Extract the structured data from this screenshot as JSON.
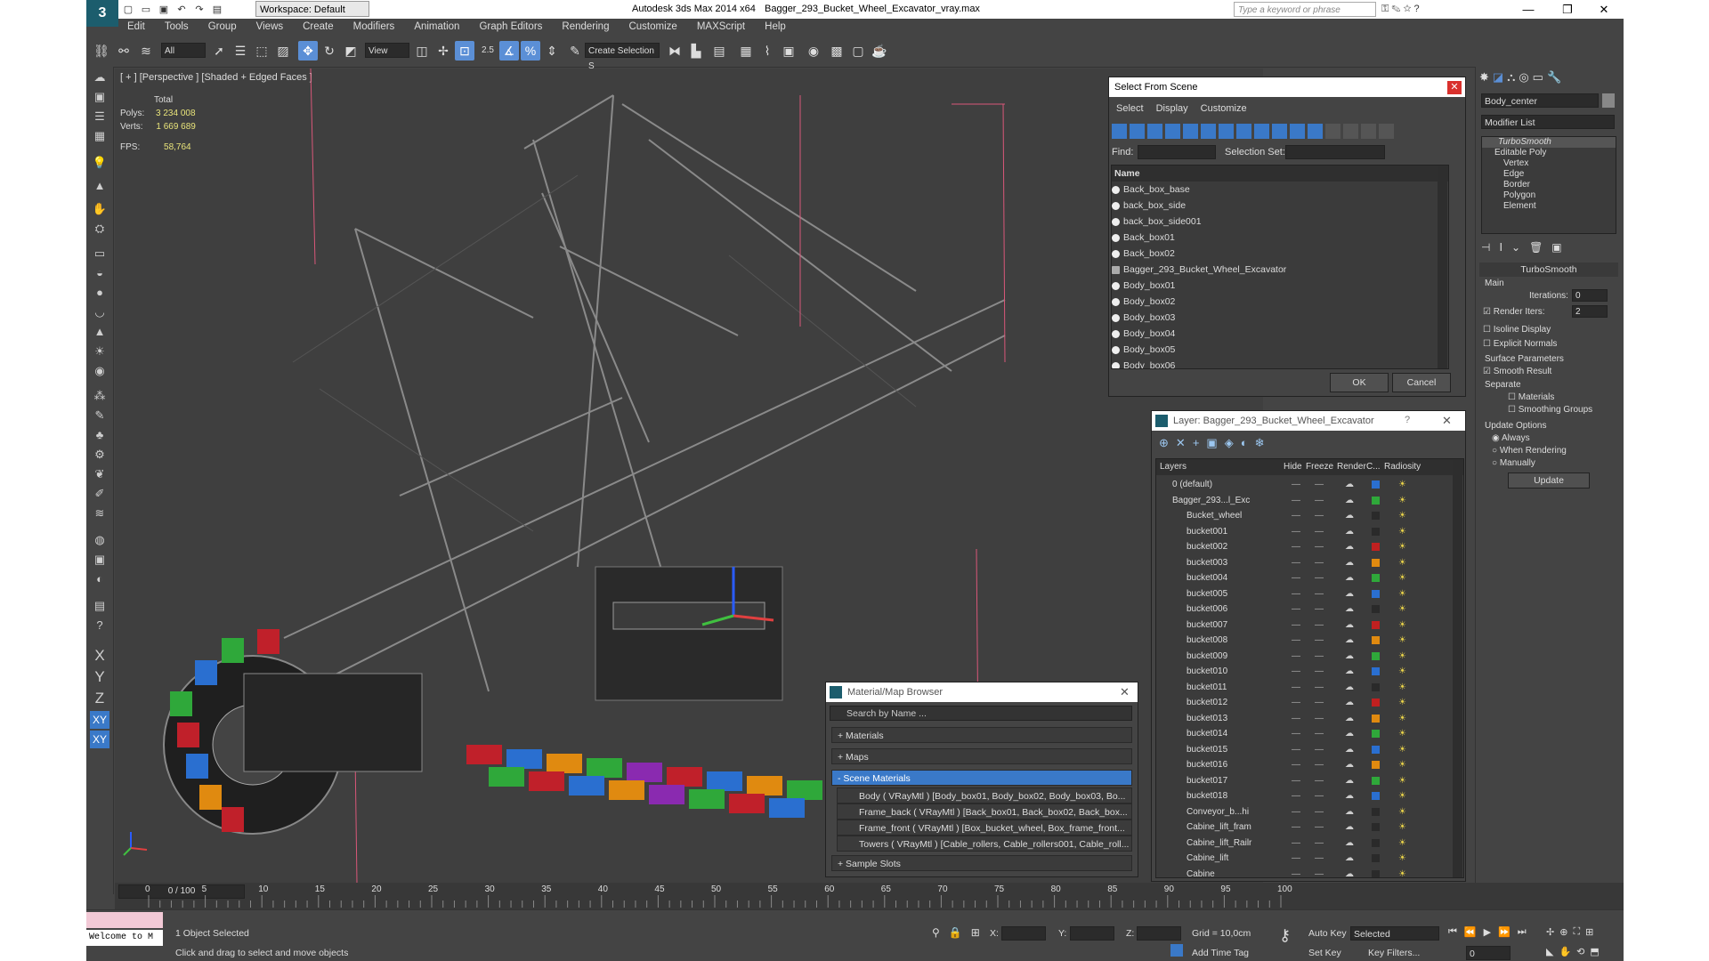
{
  "app": {
    "title": "Autodesk 3ds Max  2014 x64",
    "file": "Bagger_293_Bucket_Wheel_Excavator_vray.max",
    "workspace": "Workspace: Default",
    "search_placeholder": "Type a keyword or phrase",
    "logo": "3"
  },
  "menu": [
    "Edit",
    "Tools",
    "Group",
    "Views",
    "Create",
    "Modifiers",
    "Animation",
    "Graph Editors",
    "Rendering",
    "Customize",
    "MAXScript",
    "Help"
  ],
  "toolbar": {
    "filter": "All",
    "ref_coord": "View",
    "snap_value": "2.5",
    "selection_set": "Create Selection S"
  },
  "viewport": {
    "label": "[ + ] [Perspective ] [Shaded + Edged Faces ]",
    "stats": {
      "header": "Total",
      "polys_label": "Polys:",
      "polys": "3 234 008",
      "verts_label": "Verts:",
      "verts": "1 669 689",
      "fps_label": "FPS:",
      "fps": "58,764"
    }
  },
  "select_from_scene": {
    "title": "Select From Scene",
    "menu": [
      "Select",
      "Display",
      "Customize"
    ],
    "find_label": "Find:",
    "selset_label": "Selection Set:",
    "col_name": "Name",
    "items": [
      "Back_box_base",
      "back_box_side",
      "back_box_side001",
      "Back_box01",
      "Back_box02",
      "Bagger_293_Bucket_Wheel_Excavator",
      "Body_box01",
      "Body_box02",
      "Body_box03",
      "Body_box04",
      "Body_box05",
      "Body_box06"
    ],
    "ok": "OK",
    "cancel": "Cancel"
  },
  "layer_dialog": {
    "title": "Layer: Bagger_293_Bucket_Wheel_Excavator",
    "cols": [
      "Layers",
      "Hide",
      "Freeze",
      "Render",
      "C...",
      "Radiosity"
    ],
    "rows": [
      {
        "name": "0 (default)",
        "color": "#2a6fd0"
      },
      {
        "name": "Bagger_293...l_Exc",
        "color": "#2fa83a"
      },
      {
        "name": "Bucket_wheel",
        "color": "#2a2a2a"
      },
      {
        "name": "bucket001",
        "color": "#2a2a2a"
      },
      {
        "name": "bucket002",
        "color": "#c02020"
      },
      {
        "name": "bucket003",
        "color": "#e08a10"
      },
      {
        "name": "bucket004",
        "color": "#2fa83a"
      },
      {
        "name": "bucket005",
        "color": "#2a6fd0"
      },
      {
        "name": "bucket006",
        "color": "#2a2a2a"
      },
      {
        "name": "bucket007",
        "color": "#c02020"
      },
      {
        "name": "bucket008",
        "color": "#e08a10"
      },
      {
        "name": "bucket009",
        "color": "#2fa83a"
      },
      {
        "name": "bucket010",
        "color": "#2a6fd0"
      },
      {
        "name": "bucket011",
        "color": "#2a2a2a"
      },
      {
        "name": "bucket012",
        "color": "#c02020"
      },
      {
        "name": "bucket013",
        "color": "#e08a10"
      },
      {
        "name": "bucket014",
        "color": "#2fa83a"
      },
      {
        "name": "bucket015",
        "color": "#2a6fd0"
      },
      {
        "name": "bucket016",
        "color": "#e08a10"
      },
      {
        "name": "bucket017",
        "color": "#2fa83a"
      },
      {
        "name": "bucket018",
        "color": "#2a6fd0"
      },
      {
        "name": "Conveyor_b...hi",
        "color": "#2a2a2a"
      },
      {
        "name": "Cabine_lift_fram",
        "color": "#2a2a2a"
      },
      {
        "name": "Cabine_lift_Railr",
        "color": "#2a2a2a"
      },
      {
        "name": "Cabine_lift",
        "color": "#2a2a2a"
      },
      {
        "name": "Cabine",
        "color": "#2a2a2a"
      }
    ]
  },
  "material_browser": {
    "title": "Material/Map Browser",
    "search": "Search by Name ...",
    "sections": [
      "+ Materials",
      "+ Maps",
      "- Scene Materials",
      "+ Sample Slots"
    ],
    "scene_materials": [
      "Body  ( VRayMtl )  [Body_box01, Body_box02, Body_box03, Bo...",
      "Frame_back  ( VRayMtl )  [Back_box01, Back_box02, Back_box...",
      "Frame_front  ( VRayMtl )  [Box_bucket_wheel, Box_frame_front...",
      "Towers  ( VRayMtl )  [Cable_rollers, Cable_rollers001, Cable_roll..."
    ]
  },
  "command_panel": {
    "object_name": "Body_center",
    "modifier_list": "Modifier List",
    "stack": [
      "TurboSmooth",
      "Editable Poly",
      "Vertex",
      "Edge",
      "Border",
      "Polygon",
      "Element"
    ],
    "rollout_title": "TurboSmooth",
    "main": "Main",
    "iterations_label": "Iterations:",
    "iterations": "0",
    "render_iters_label": "Render Iters:",
    "render_iters": "2",
    "isoline": "Isoline Display",
    "explicit": "Explicit Normals",
    "surface": "Surface Parameters",
    "smooth_result": "Smooth Result",
    "separate": "Separate",
    "materials": "Materials",
    "smoothing_groups": "Smoothing Groups",
    "update_options": "Update Options",
    "always": "Always",
    "when_rendering": "When Rendering",
    "manually": "Manually",
    "update": "Update"
  },
  "timeline": {
    "frame": "0 / 100",
    "ticks": [
      "0",
      "5",
      "10",
      "15",
      "20",
      "25",
      "30",
      "35",
      "40",
      "45",
      "50",
      "55",
      "60",
      "65",
      "70",
      "75",
      "80",
      "85",
      "90",
      "95",
      "100"
    ]
  },
  "status": {
    "welcome": "Welcome to M",
    "selected": "1 Object Selected",
    "prompt": "Click and drag to select and move objects",
    "x_label": "X:",
    "y_label": "Y:",
    "z_label": "Z:",
    "grid": "Grid = 10,0cm",
    "add_time_tag": "Add Time Tag",
    "auto_key": "Auto Key",
    "set_key": "Set Key",
    "key_selected": "Selected",
    "key_filters": "Key Filters...",
    "frame_field": "0"
  },
  "axis_labels": [
    "X",
    "Y",
    "Z",
    "XY",
    "XY"
  ]
}
